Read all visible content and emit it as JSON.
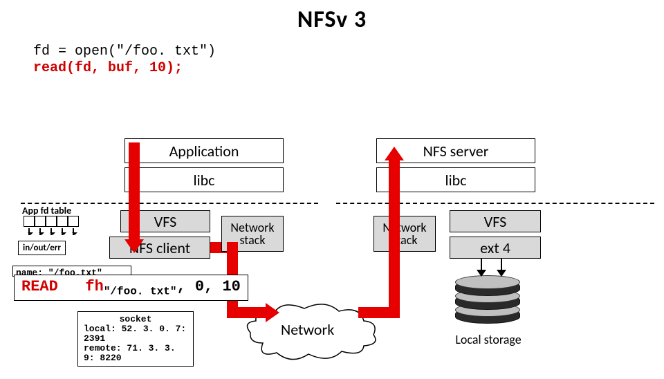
{
  "title": "NFSv 3",
  "code_line1": "fd = open(\"/foo. txt\")",
  "code_line2": "read(fd, buf, 10);",
  "client": {
    "application": "Application",
    "libc": "libc",
    "vfs": "VFS",
    "nfs_client": "NFS client",
    "net_stack": "Network\nstack"
  },
  "server": {
    "nfs_server": "NFS server",
    "libc": "libc",
    "vfs": "VFS",
    "ext4": "ext 4",
    "net_stack": "Network\nstack",
    "storage": "Local storage"
  },
  "side": {
    "fd_table_label": "App fd table",
    "in_out_err": "in/out/err",
    "name_line1": "name: \"/foo.txt\""
  },
  "packet": {
    "kw": "READ",
    "fh": "fh",
    "sub": "\"/foo. txt\"",
    "suffix": ", 0, 10"
  },
  "socket": {
    "line1": "socket",
    "line2": "local:  52. 3. 0. 7: 2391",
    "line3": "remote: 71. 3. 3. 9: 8220"
  },
  "network_cloud": "Network"
}
